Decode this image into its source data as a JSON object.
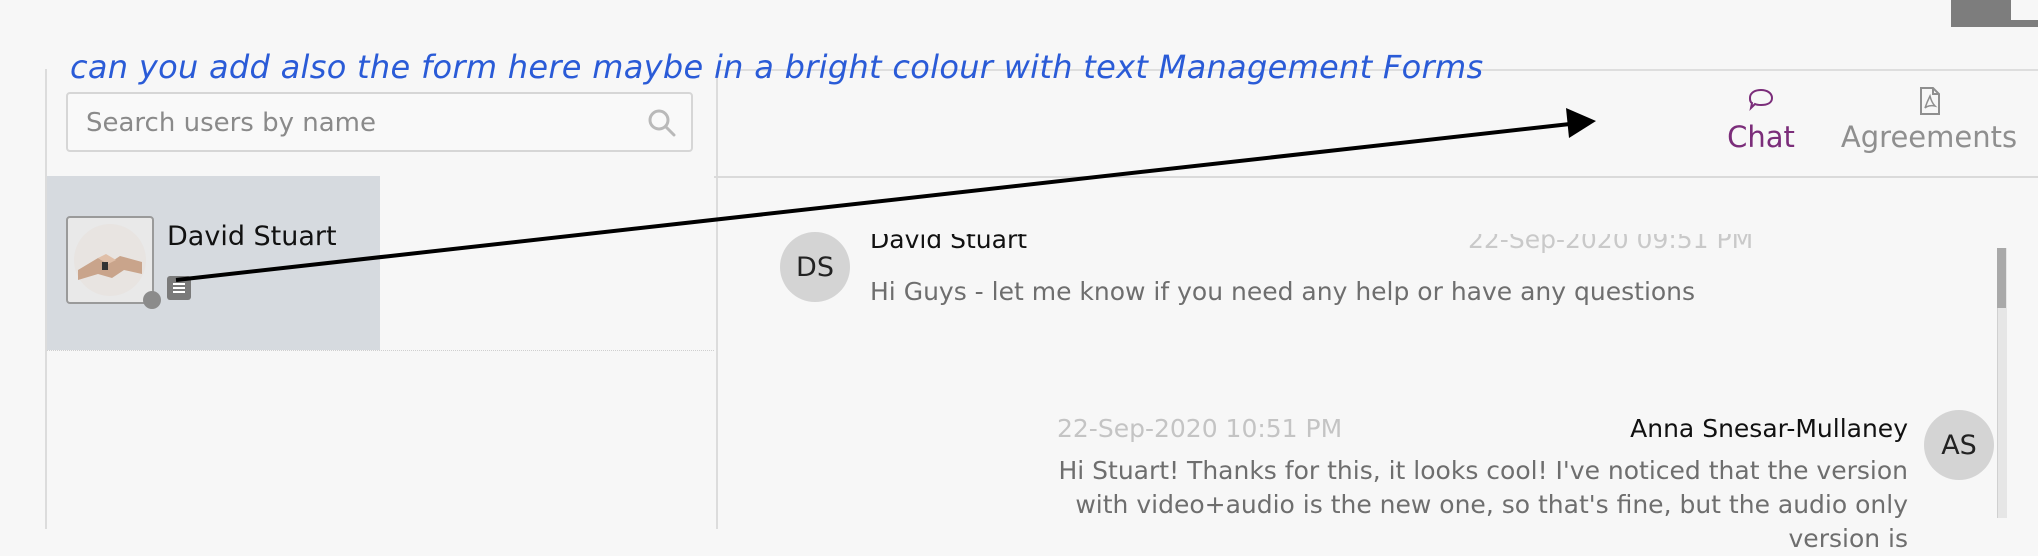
{
  "annotation": {
    "text": "can you add also the form here maybe in a bright colour with text Management Forms",
    "color": "#2a5bd7"
  },
  "search": {
    "placeholder": "Search users by name",
    "value": "",
    "icon": "search-icon"
  },
  "users": [
    {
      "name": "David Stuart",
      "status": "offline",
      "badge_icon": "document-icon",
      "avatar": "handshake-photo"
    }
  ],
  "tabs": [
    {
      "label": "Chat",
      "icon": "speech-bubble-icon",
      "active": true,
      "color": "#7b2d7a"
    },
    {
      "label": "Agreements",
      "icon": "pdf-file-icon",
      "active": false,
      "color": "#8f8f8f"
    }
  ],
  "messages": [
    {
      "initials": "DS",
      "sender": "David Stuart",
      "time": "22-Sep-2020 09:51 PM",
      "text": "Hi Guys - let me know if you need any help or have any questions",
      "side": "left"
    },
    {
      "initials": "AS",
      "sender": "Anna Snesar-Mullaney",
      "time": "22-Sep-2020 10:51 PM",
      "text": "Hi Stuart! Thanks for this, it looks cool! I've noticed that the version with video+audio is the new one, so that's fine, but the audio only version is",
      "side": "right"
    }
  ]
}
